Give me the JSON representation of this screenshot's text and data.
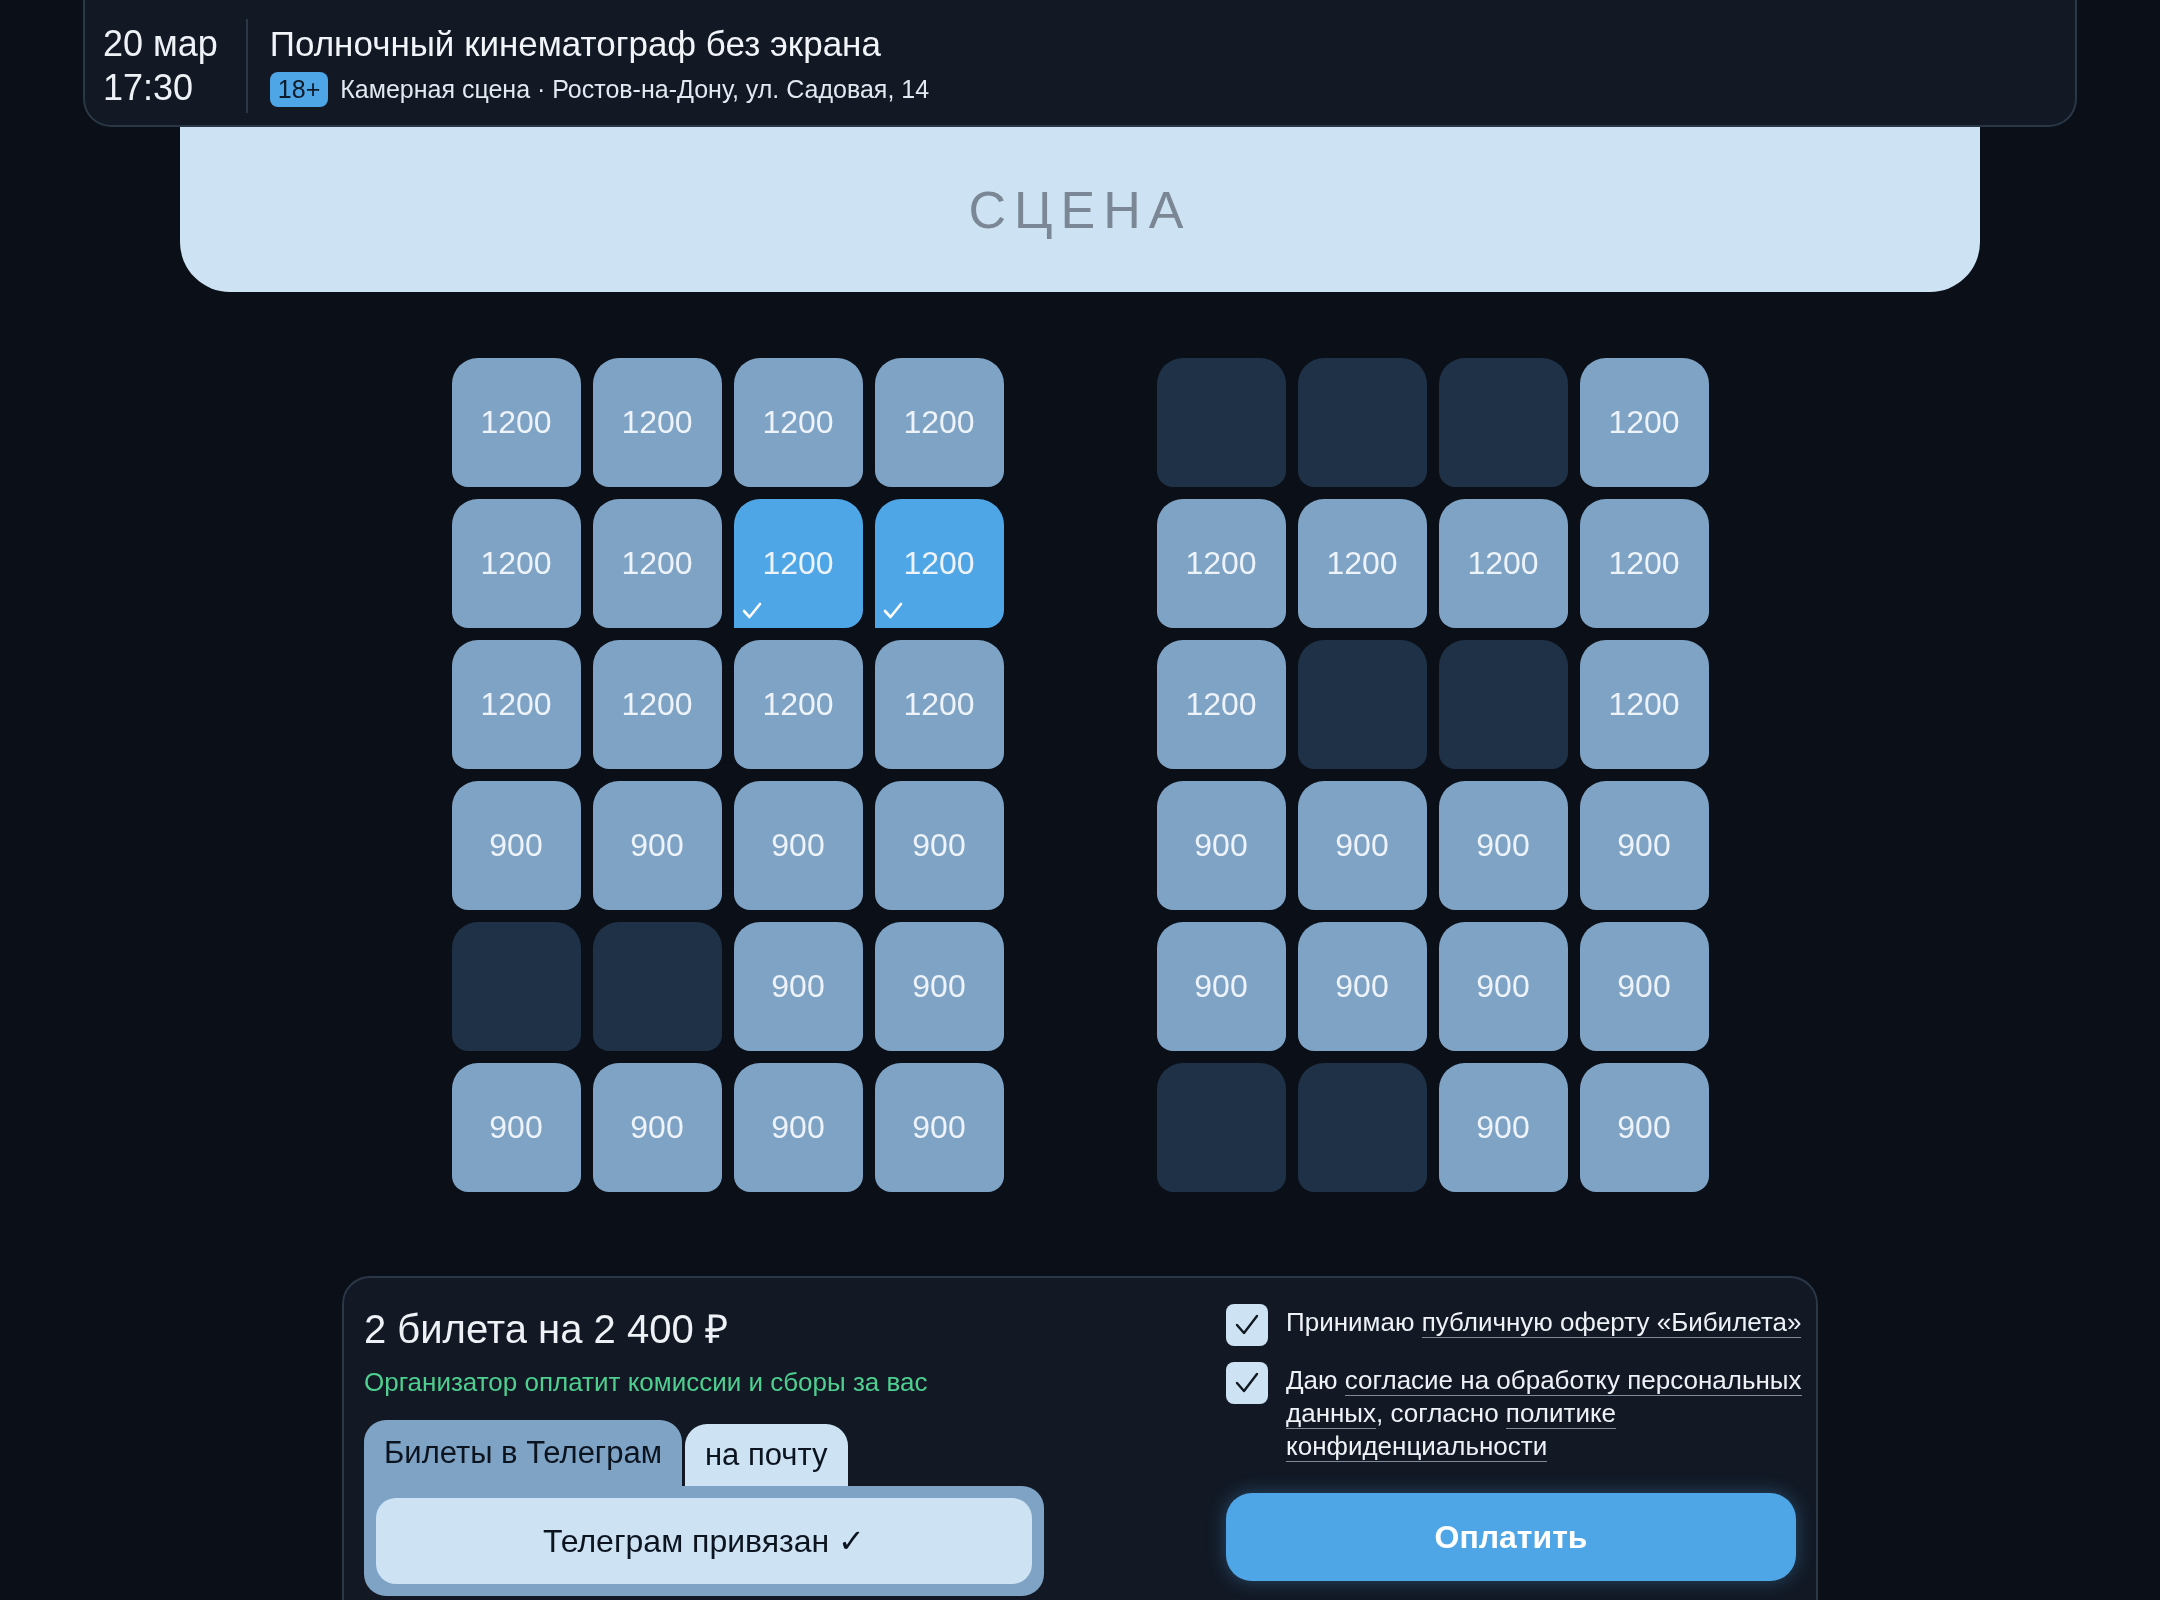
{
  "event": {
    "date": "20 мар",
    "time": "17:30",
    "title": "Полночный кинематограф без экрана",
    "age_badge": "18+",
    "venue": "Камерная сцена · Ростов-на-Дону, ул. Садовая, 14"
  },
  "stage": {
    "label": "СЦЕНА"
  },
  "blocks": [
    {
      "rows": [
        {
          "seats": [
            {
              "price": "1200",
              "selected": false,
              "taken": false
            },
            {
              "price": "1200",
              "selected": false,
              "taken": false
            },
            {
              "price": "1200",
              "selected": false,
              "taken": false
            },
            {
              "price": "1200",
              "selected": false,
              "taken": false
            }
          ]
        },
        {
          "seats": [
            {
              "price": "1200",
              "selected": false,
              "taken": false
            },
            {
              "price": "1200",
              "selected": false,
              "taken": false
            },
            {
              "price": "1200",
              "selected": true,
              "taken": false
            },
            {
              "price": "1200",
              "selected": true,
              "taken": false
            }
          ]
        },
        {
          "seats": [
            {
              "price": "1200",
              "selected": false,
              "taken": false
            },
            {
              "price": "1200",
              "selected": false,
              "taken": false
            },
            {
              "price": "1200",
              "selected": false,
              "taken": false
            },
            {
              "price": "1200",
              "selected": false,
              "taken": false
            }
          ]
        },
        {
          "seats": [
            {
              "price": "900",
              "selected": false,
              "taken": false
            },
            {
              "price": "900",
              "selected": false,
              "taken": false
            },
            {
              "price": "900",
              "selected": false,
              "taken": false
            },
            {
              "price": "900",
              "selected": false,
              "taken": false
            }
          ]
        },
        {
          "seats": [
            {
              "selected": false,
              "taken": true
            },
            {
              "selected": false,
              "taken": true
            },
            {
              "price": "900",
              "selected": false,
              "taken": false
            },
            {
              "price": "900",
              "selected": false,
              "taken": false
            }
          ]
        },
        {
          "seats": [
            {
              "price": "900",
              "selected": false,
              "taken": false
            },
            {
              "price": "900",
              "selected": false,
              "taken": false
            },
            {
              "price": "900",
              "selected": false,
              "taken": false
            },
            {
              "price": "900",
              "selected": false,
              "taken": false
            }
          ]
        }
      ]
    },
    {
      "rows": [
        {
          "seats": [
            {
              "selected": false,
              "taken": true
            },
            {
              "selected": false,
              "taken": true
            },
            {
              "selected": false,
              "taken": true
            },
            {
              "price": "1200",
              "selected": false,
              "taken": false
            }
          ]
        },
        {
          "seats": [
            {
              "price": "1200",
              "selected": false,
              "taken": false
            },
            {
              "price": "1200",
              "selected": false,
              "taken": false
            },
            {
              "price": "1200",
              "selected": false,
              "taken": false
            },
            {
              "price": "1200",
              "selected": false,
              "taken": false
            }
          ]
        },
        {
          "seats": [
            {
              "price": "1200",
              "selected": false,
              "taken": false
            },
            {
              "selected": false,
              "taken": true
            },
            {
              "selected": false,
              "taken": true
            },
            {
              "price": "1200",
              "selected": false,
              "taken": false
            }
          ]
        },
        {
          "seats": [
            {
              "price": "900",
              "selected": false,
              "taken": false
            },
            {
              "price": "900",
              "selected": false,
              "taken": false
            },
            {
              "price": "900",
              "selected": false,
              "taken": false
            },
            {
              "price": "900",
              "selected": false,
              "taken": false
            }
          ]
        },
        {
          "seats": [
            {
              "price": "900",
              "selected": false,
              "taken": false
            },
            {
              "price": "900",
              "selected": false,
              "taken": false
            },
            {
              "price": "900",
              "selected": false,
              "taken": false
            },
            {
              "price": "900",
              "selected": false,
              "taken": false
            }
          ]
        },
        {
          "seats": [
            {
              "selected": false,
              "taken": true
            },
            {
              "selected": false,
              "taken": true
            },
            {
              "price": "900",
              "selected": false,
              "taken": false
            },
            {
              "price": "900",
              "selected": false,
              "taken": false
            }
          ]
        }
      ]
    }
  ],
  "summary": {
    "total": "2 билета на 2 400 ₽",
    "note": "Организатор оплатит комиссии и сборы за вас",
    "tabs": [
      {
        "label": "Билеты в Телеграм",
        "selected": true
      },
      {
        "label": "на почту",
        "selected": false
      }
    ],
    "status_button": "Телеграм привязан ✓"
  },
  "consents": [
    {
      "checked": true,
      "parts": [
        {
          "text": "Принимаю "
        },
        {
          "text": "публичную оферту «Бибилета»",
          "link": true
        }
      ]
    },
    {
      "checked": true,
      "parts": [
        {
          "text": "Даю "
        },
        {
          "text": "согласие на обработку персональных",
          "link": true
        },
        {
          "text": "данных",
          "link": true
        },
        {
          "text": ", согласно "
        },
        {
          "text": "политике",
          "link": true
        },
        {
          "text": "конфиденциальности",
          "link": true
        }
      ]
    }
  ],
  "pay_button": "Оплатить"
}
